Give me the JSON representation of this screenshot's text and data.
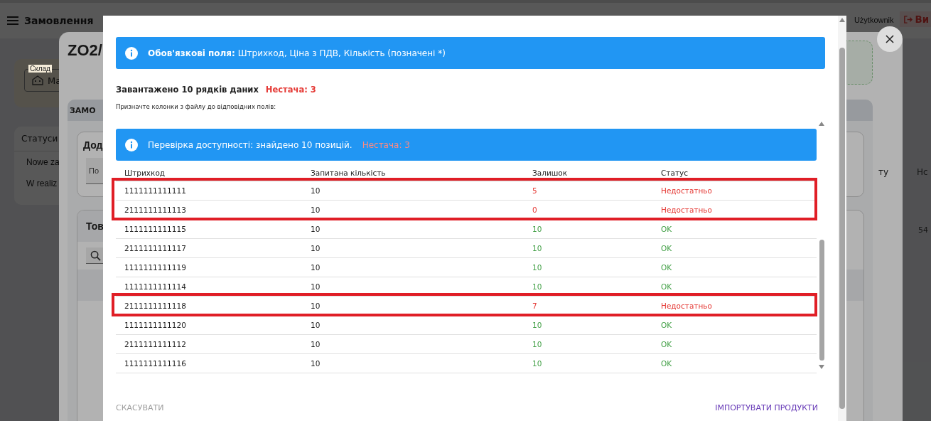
{
  "app_bar": {
    "title": "Замовлення",
    "user": "Użytkownik",
    "logout": "Ви"
  },
  "background": {
    "warehouse_label": "Склад",
    "warehouse_value": "Ma",
    "statuses_title": "Статуси",
    "statuses": [
      "Nowe za",
      "W realiz"
    ]
  },
  "order_dialog": {
    "title": "ZO2/",
    "tab": "ЗАМО",
    "add_card_title": "Дод",
    "add_field_placeholder": "По",
    "products_card_title": "Тов",
    "columns": [
      "ту",
      "Нс"
    ],
    "cell": "54"
  },
  "import_dialog": {
    "required_alert": {
      "label": "Обов'язкові поля:",
      "text": "Штрихкод, Ціна з ПДВ, Кількість (позначені *)"
    },
    "loaded": "Завантажено 10 рядків даних",
    "shortage": "Нестача: 3",
    "hint": "Призначте колонки з файлу до відповідних полів:",
    "availability_alert": {
      "text": "Перевірка доступності: знайдено 10 позицій.",
      "shortage": "Нестача: 3"
    },
    "columns": [
      "Штрихкод",
      "Запитана кількість",
      "Залишок",
      "Статус"
    ],
    "rows": [
      {
        "barcode": "1111111111111",
        "requested": "10",
        "stock": "5",
        "status": "Недостатньо",
        "short": true,
        "highlighted": true
      },
      {
        "barcode": "2111111111113",
        "requested": "10",
        "stock": "0",
        "status": "Недостатньо",
        "short": true,
        "highlighted": true
      },
      {
        "barcode": "1111111111115",
        "requested": "10",
        "stock": "10",
        "status": "OK",
        "short": false,
        "highlighted": false
      },
      {
        "barcode": "2111111111117",
        "requested": "10",
        "stock": "10",
        "status": "OK",
        "short": false,
        "highlighted": false
      },
      {
        "barcode": "1111111111119",
        "requested": "10",
        "stock": "10",
        "status": "OK",
        "short": false,
        "highlighted": false
      },
      {
        "barcode": "1111111111114",
        "requested": "10",
        "stock": "10",
        "status": "OK",
        "short": false,
        "highlighted": false
      },
      {
        "barcode": "2111111111118",
        "requested": "10",
        "stock": "7",
        "status": "Недостатньо",
        "short": true,
        "highlighted": true
      },
      {
        "barcode": "1111111111120",
        "requested": "10",
        "stock": "10",
        "status": "OK",
        "short": false,
        "highlighted": false
      },
      {
        "barcode": "2111111111112",
        "requested": "10",
        "stock": "10",
        "status": "OK",
        "short": false,
        "highlighted": false
      },
      {
        "barcode": "1111111111116",
        "requested": "10",
        "stock": "10",
        "status": "OK",
        "short": false,
        "highlighted": false
      }
    ],
    "cancel": "СКАСУВАТИ",
    "import": "ІМПОРТУВАТИ ПРОДУКТИ"
  }
}
